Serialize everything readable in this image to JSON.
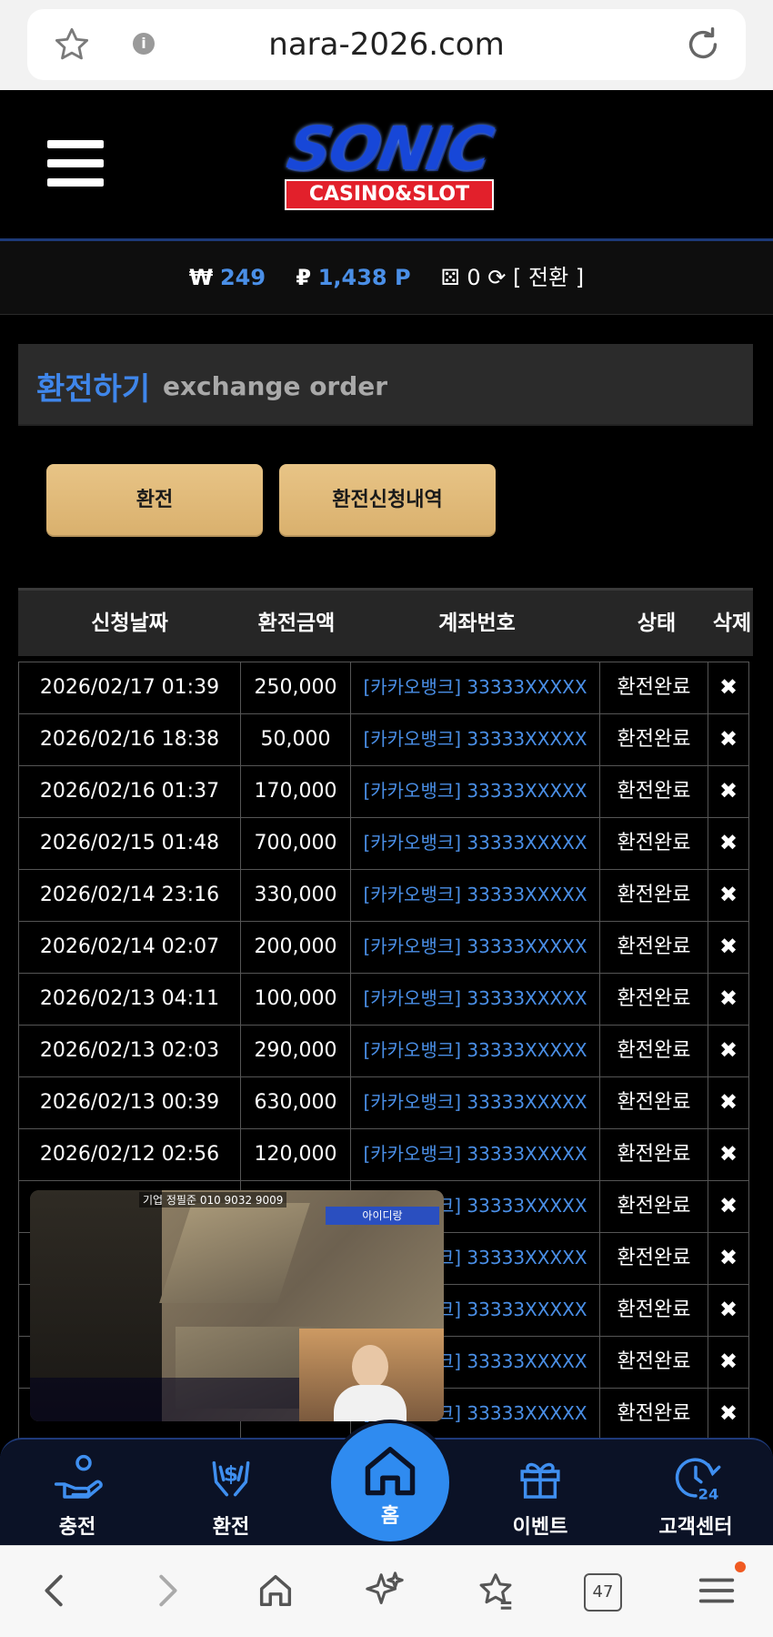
{
  "browser": {
    "url": "nara-2026.com",
    "tab_count": "47"
  },
  "header": {
    "logo_text": "SONIC",
    "logo_sub": "CASINO&SLOT"
  },
  "balance": {
    "won_symbol": "₩",
    "won_value": "249",
    "point_symbol": "₽",
    "point_value": "1,438 P",
    "chip_value": "0",
    "convert_label": "[ 전환 ]"
  },
  "section": {
    "title_ko": "환전하기",
    "title_en": "exchange order"
  },
  "buttons": {
    "exchange": "환전",
    "history": "환전신청내역"
  },
  "table": {
    "headers": [
      "신청날짜",
      "환전금액",
      "계좌번호",
      "상태",
      "삭제"
    ],
    "rows": [
      {
        "date": "2026/02/17 01:39",
        "amount": "250,000",
        "account": "[카카오뱅크] 33333XXXXX",
        "status": "환전완료"
      },
      {
        "date": "2026/02/16 18:38",
        "amount": "50,000",
        "account": "[카카오뱅크] 33333XXXXX",
        "status": "환전완료"
      },
      {
        "date": "2026/02/16 01:37",
        "amount": "170,000",
        "account": "[카카오뱅크] 33333XXXXX",
        "status": "환전완료"
      },
      {
        "date": "2026/02/15 01:48",
        "amount": "700,000",
        "account": "[카카오뱅크] 33333XXXXX",
        "status": "환전완료"
      },
      {
        "date": "2026/02/14 23:16",
        "amount": "330,000",
        "account": "[카카오뱅크] 33333XXXXX",
        "status": "환전완료"
      },
      {
        "date": "2026/02/14 02:07",
        "amount": "200,000",
        "account": "[카카오뱅크] 33333XXXXX",
        "status": "환전완료"
      },
      {
        "date": "2026/02/13 04:11",
        "amount": "100,000",
        "account": "[카카오뱅크] 33333XXXXX",
        "status": "환전완료"
      },
      {
        "date": "2026/02/13 02:03",
        "amount": "290,000",
        "account": "[카카오뱅크] 33333XXXXX",
        "status": "환전완료"
      },
      {
        "date": "2026/02/13 00:39",
        "amount": "630,000",
        "account": "[카카오뱅크] 33333XXXXX",
        "status": "환전완료"
      },
      {
        "date": "2026/02/12 02:56",
        "amount": "120,000",
        "account": "[카카오뱅크] 33333XXXXX",
        "status": "환전완료"
      },
      {
        "date": "",
        "amount": "",
        "account": "[카카오뱅크] 33333XXXXX",
        "status": "환전완료"
      },
      {
        "date": "",
        "amount": "",
        "account": "[카카오뱅크] 33333XXXXX",
        "status": "환전완료"
      },
      {
        "date": "",
        "amount": "",
        "account": "[카카오뱅크] 33333XXXXX",
        "status": "환전완료"
      },
      {
        "date": "",
        "amount": "",
        "account": "[카카오뱅크] 33333XXXXX",
        "status": "환전완료"
      },
      {
        "date": "",
        "amount": "",
        "account": "[카카오뱅크] 33333XXXXX",
        "status": "환전완료"
      }
    ],
    "delete_symbol": "✖"
  },
  "video": {
    "caption": "기업 정필준 010 9032 9009",
    "tag": "아이디랑"
  },
  "bottom_nav": {
    "charge": "충전",
    "exchange": "환전",
    "home": "홈",
    "event": "이벤트",
    "support": "고객센터"
  },
  "icons": {
    "charge": "hand-coin-icon",
    "exchange": "hands-dollar-icon",
    "home": "house-icon",
    "event": "gift-icon",
    "support": "24-hours-icon"
  },
  "colors": {
    "accent": "#4a8fe7",
    "button": "#e2bd7c",
    "home": "#2f8bf0",
    "logo_red": "#e2202b"
  }
}
